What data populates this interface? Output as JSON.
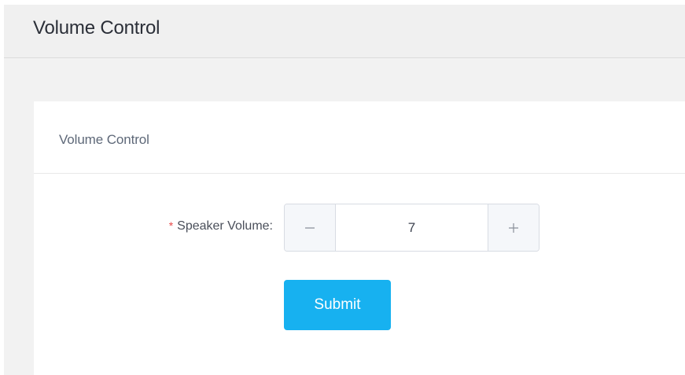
{
  "header": {
    "title": "Volume Control"
  },
  "card": {
    "title": "Volume Control",
    "form": {
      "speaker_volume": {
        "required_marker": "*",
        "label": "Speaker Volume:",
        "value": "7"
      },
      "submit_label": "Submit"
    }
  },
  "icons": {
    "decrement": "minus-icon",
    "increment": "plus-icon"
  },
  "colors": {
    "primary_button": "#17b1f0",
    "required_marker": "#e84848"
  }
}
